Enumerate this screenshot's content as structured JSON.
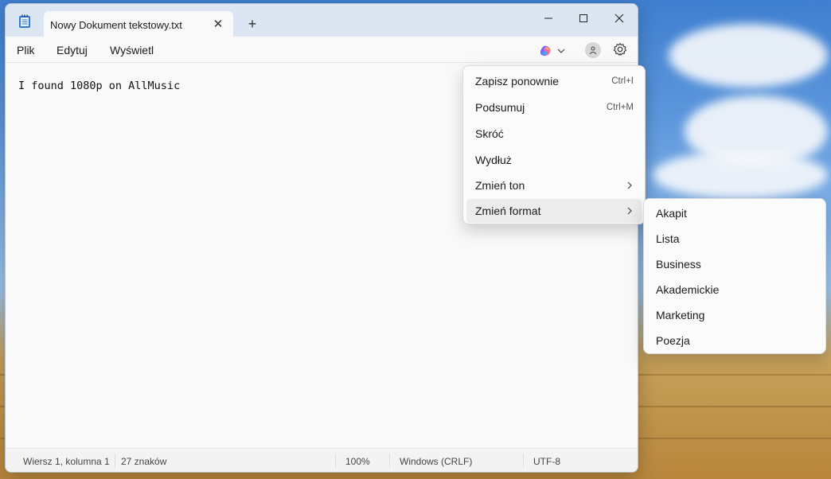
{
  "window": {
    "tab_title": "Nowy Dokument tekstowy.txt",
    "tab_close": "✕",
    "new_tab": "+"
  },
  "menubar": {
    "file": "Plik",
    "edit": "Edytuj",
    "view": "Wyświetl"
  },
  "editor": {
    "content": "I found 1080p on AllMusic"
  },
  "rewrite_menu": {
    "items": [
      {
        "label": "Zapisz ponownie",
        "shortcut": "Ctrl+I"
      },
      {
        "label": "Podsumuj",
        "shortcut": "Ctrl+M"
      },
      {
        "label": "Skróć",
        "shortcut": ""
      },
      {
        "label": "Wydłuż",
        "shortcut": ""
      },
      {
        "label": "Zmień ton",
        "shortcut": ""
      },
      {
        "label": "Zmień format",
        "shortcut": ""
      }
    ]
  },
  "format_submenu": {
    "items": [
      "Akapit",
      "Lista",
      "Business",
      "Akademickie",
      "Marketing",
      "Poezja"
    ]
  },
  "status": {
    "position": "Wiersz 1, kolumna 1",
    "chars": "27 znaków",
    "zoom": "100%",
    "line_endings": "Windows (CRLF)",
    "encoding": "UTF-8"
  },
  "colors": {
    "titlebar": "#dce6f2",
    "accent_blue": "#3f7fd0"
  },
  "icons": {
    "app": "notepad-icon",
    "copilot": "copilot-icon",
    "account": "account-icon",
    "settings": "gear-icon"
  }
}
